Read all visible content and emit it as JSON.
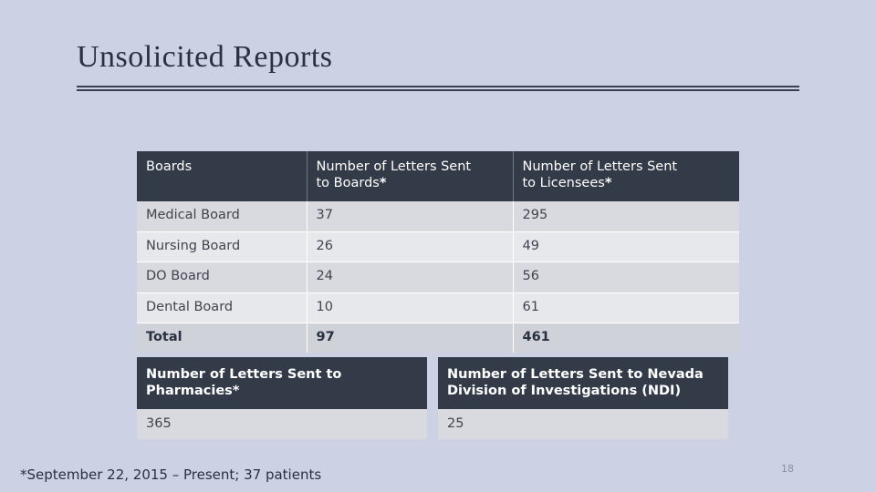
{
  "slide": {
    "title": "Unsolicited Reports",
    "page_number": "18",
    "footnote": "*September 22, 2015 – Present; 37 patients"
  },
  "main_table": {
    "headers": {
      "col1": "Boards",
      "col2_line1": "Number of Letters Sent",
      "col2_line2": "to Boards",
      "col2_asterisk": "*",
      "col3_line1": "Number of Letters Sent",
      "col3_line2": "to Licensees",
      "col3_asterisk": "*"
    },
    "rows": [
      {
        "board": "Medical Board",
        "to_boards": "37",
        "to_licensees": "295"
      },
      {
        "board": "Nursing Board",
        "to_boards": "26",
        "to_licensees": "49"
      },
      {
        "board": "DO Board",
        "to_boards": "24",
        "to_licensees": "56"
      },
      {
        "board": "Dental Board",
        "to_boards": "10",
        "to_licensees": "61"
      }
    ],
    "total_row": {
      "board": "Total",
      "to_boards": "97",
      "to_licensees": "461"
    }
  },
  "lower_boxes": [
    {
      "header_line1": "Number of Letters Sent to",
      "header_line2": "Pharmacies*",
      "value": "365"
    },
    {
      "header_line1": "Number of Letters Sent to Nevada",
      "header_line2": "Division of Investigations (NDI)",
      "value": "25"
    }
  ],
  "colors": {
    "background": "#ccd2e4",
    "header_dark": "#333b49",
    "row_light": "#e6e8ec",
    "row_dark": "#d8dae0",
    "total_row": "#cfd2d9",
    "title_text": "#2b3040"
  }
}
